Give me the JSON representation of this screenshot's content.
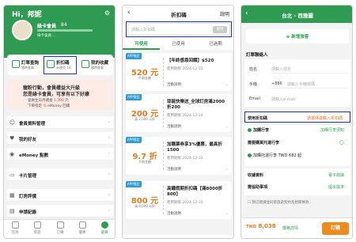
{
  "phone1": {
    "greeting": "Hi，邦妮",
    "member": "綠卡會員",
    "points": "84",
    "level_note": "綠卡會員 ...",
    "tiles": [
      {
        "label": "訂單查詢",
        "sub": "隨時查詢"
      },
      {
        "label": "折扣碼",
        "sub": "未使用 10"
      },
      {
        "label": "我的收藏",
        "sub": "隨時查看"
      }
    ],
    "promo": {
      "line1": "寵粉行動，會員權益大升級",
      "line2": "您是綠卡會員，可享有以下好康",
      "body1_a": "會員生日月禮金 ",
      "body1_amount": "1,300",
      "body1_b": " 元",
      "body2_a": "下單指定 ",
      "body2_b": " eMoney 回饋"
    },
    "menu": [
      "會員資料管理",
      "我的好友",
      "eMoney 點數",
      "卡片管理",
      "訂房評價",
      "申請紀錄"
    ],
    "tabs": [
      "首頁",
      "旅遊",
      "訂購",
      "優惠",
      "會員"
    ]
  },
  "phone2": {
    "title": "折扣碼",
    "help": "說明",
    "search_placeholder": "請輸入折扣碼",
    "search_button": "使用",
    "tabs": [
      "可使用",
      "已使用",
      "已過期"
    ],
    "badge": "APP限定",
    "coupons": [
      {
        "amount": "520 元",
        "cond": "不限金額",
        "name": "【年終感恩回饋】$520",
        "date": "使用期限 2024-12-31",
        "act": "活動說明"
      },
      {
        "amount": "200 元",
        "cond": "滿 2,000 元折",
        "name": "耶誕快樂送_全球訂房滿2000折200",
        "date": "使用期限 2024-12-24",
        "act": "活動說明"
      },
      {
        "amount": "9.7 折",
        "cond": "不限金額",
        "name": "加購票券享3%優惠，最高折1500",
        "date": "使用期限 2024-12-31",
        "act": "活動說明"
      },
      {
        "amount": "800 元",
        "cond": "滿 8,000 元折",
        "name": "高鐵假期折扣碼【滿8000折800】",
        "date": "使用期限 2024-12-31",
        "act": "活動說明"
      }
    ]
  },
  "phone3": {
    "title": "台北 - 西雅圖",
    "add_passenger": "新增旅客",
    "contact_title": "訂單聯絡人",
    "fields": [
      {
        "label": "姓名",
        "placeholder": "請輸入姓名"
      },
      {
        "label": "手機",
        "prefix": "+886",
        "placeholder": "請輸入手機號碼"
      },
      {
        "label": "Email",
        "placeholder": "請輸入e-mail"
      }
    ],
    "coupon_label": "使用折扣碼",
    "coupon_value": "請選擇或輸入折扣碼",
    "rows": [
      {
        "label": "加購行李",
        "value": "加購行李須知"
      },
      {
        "label": "需要購買托運行李",
        "value": ""
      },
      {
        "label": "加購托運行李 TWD 682 起",
        "value": ""
      },
      {
        "label": "收據資料",
        "value": "電子收據"
      },
      {
        "label": "需協助事項",
        "value": "提出需求"
      }
    ],
    "note": "我已閱讀並同意旅遊契約及相關條款...",
    "total_prefix": "TWD",
    "total": "8,038",
    "price_detail": "價格詳情",
    "order_button": "訂購"
  },
  "colors": {
    "green": "#2f9b52",
    "orange": "#e07a1f",
    "blue_highlight": "#1d2fd6",
    "badge": "#2e9bd6"
  }
}
